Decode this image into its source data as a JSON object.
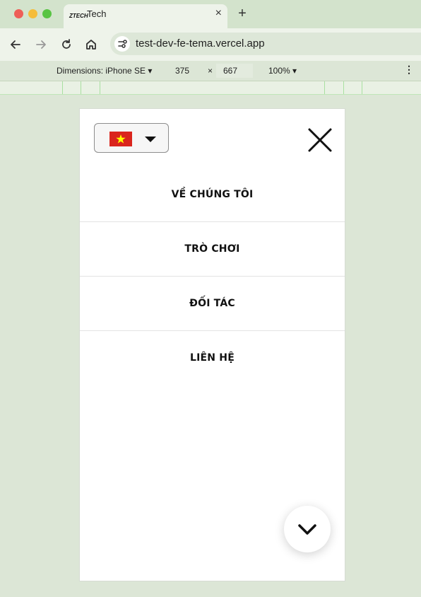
{
  "browser": {
    "tab": {
      "title": "Tech",
      "favicon_text": "ZTECH",
      "close_glyph": "×"
    },
    "new_tab_glyph": "+",
    "url": "test-dev-fe-tema.vercel.app",
    "icons": [
      "back-arrow-icon",
      "forward-arrow-icon",
      "reload-icon",
      "home-icon",
      "site-info-icon"
    ]
  },
  "devtools": {
    "dimensions_label": "Dimensions: iPhone SE ▾",
    "width": "375",
    "times": "×",
    "height": "667",
    "zoom_label": "100% ▾",
    "more_glyph": "⋮"
  },
  "app": {
    "language": {
      "selected": "Vietnamese",
      "flag_colors": {
        "field": "#da251d",
        "star": "#ffff00"
      }
    },
    "menu": [
      {
        "label": "VỀ CHÚNG TÔI"
      },
      {
        "label": "TRÒ CHƠI"
      },
      {
        "label": "ĐỐI TÁC"
      },
      {
        "label": "LIÊN HỆ"
      }
    ],
    "close_icon": "close-icon",
    "fab_icon": "chevron-down-icon"
  }
}
